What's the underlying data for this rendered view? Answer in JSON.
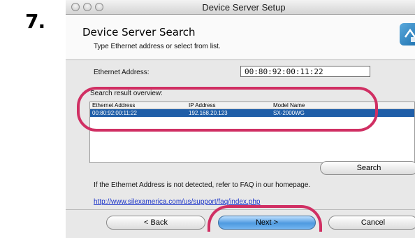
{
  "step_number": "7.",
  "window": {
    "title": "Device Server Setup"
  },
  "header": {
    "title": "Device Server Search",
    "subtitle": "Type Ethernet address or select from list."
  },
  "ethernet": {
    "label": "Ethernet Address:",
    "value": "00:80:92:00:11:22"
  },
  "results": {
    "label": "Search result overview:",
    "columns": [
      "Ethernet Address",
      "IP Address",
      "Model Name"
    ],
    "rows": [
      {
        "ethernet": "00:80:92:00:11:22",
        "ip": "192.168.20.123",
        "model": "SX-2000WG",
        "selected": true
      }
    ]
  },
  "search_button": "Search",
  "note": "If the Ethernet Address is not detected, refer to FAQ in our homepage.",
  "link": "http://www.silexamerica.com/us/support/faq/index.php",
  "buttons": {
    "back": "< Back",
    "next": "Next >",
    "cancel": "Cancel"
  },
  "colors": {
    "highlight_ring": "#d02f63",
    "selected_row": "#1f5ea8",
    "link": "#1a33c9"
  }
}
